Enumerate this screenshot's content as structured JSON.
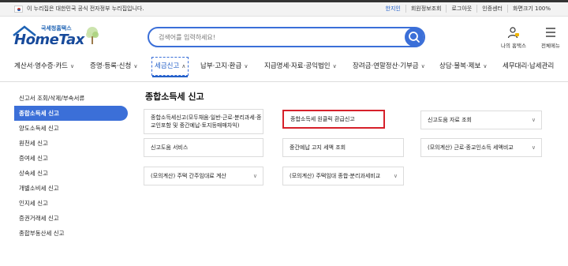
{
  "gov_banner": {
    "notice": "이 누리집은 대한민국 공식 전자정부 누리집입니다.",
    "links": [
      "한지인",
      "회원정보조회",
      "로그아웃",
      "인증센터",
      "화면크기 100%"
    ]
  },
  "logo": {
    "tagline": "국세청홈택스",
    "brand": "HomeTax"
  },
  "search": {
    "placeholder": "검색어를 입력하세요!"
  },
  "header_icons": {
    "myhome_label": "나의 홈택스",
    "allmenu_label": "전체메뉴"
  },
  "nav": {
    "items": [
      "계산서·영수증·카드",
      "증명·등록·신청",
      "세금신고",
      "납부·고지·환급",
      "지급명세·자료·공익법인",
      "장려금·연말정산·기부금",
      "상담·불복·제보",
      "세무대리·납세관리"
    ],
    "active_index": 2
  },
  "sidebar": {
    "items": [
      "신고서 조회/삭제/부속서류",
      "종합소득세 신고",
      "양도소득세 신고",
      "원천세 신고",
      "증여세 신고",
      "상속세 신고",
      "개별소비세 신고",
      "인지세 신고",
      "증권거래세 신고",
      "종합부동산세 신고"
    ],
    "active_index": 1
  },
  "content": {
    "title": "종합소득세 신고",
    "cards": [
      "종합소득세신고(모두채움·일반·근로·분리과세·종교인포함 및 중간예납·토지등매매차익)",
      "종합소득세 원클릭 환급신고",
      "신고도움 자료 조회",
      "신고도움 서비스",
      "중간예납 고지 세액 조회",
      "(모의계산) 근로·종교인소득 세액비교",
      "(모의계산) 주택 간주임대료 계산",
      "(모의계산) 주택임대 종합·분리과세비교"
    ]
  },
  "colors": {
    "accent": "#3b6fd8",
    "highlight_border": "#d6202a",
    "brand": "#174a9b"
  }
}
